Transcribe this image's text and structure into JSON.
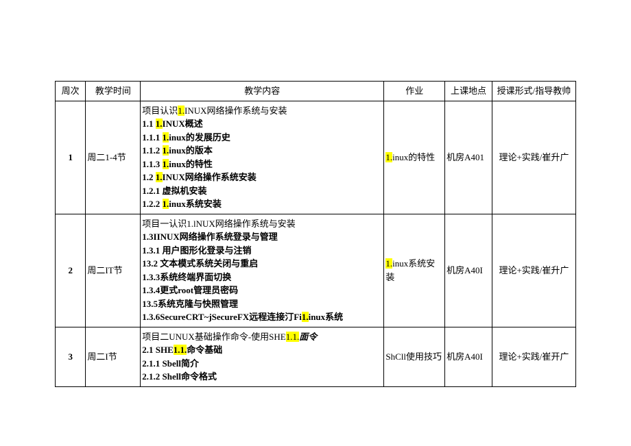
{
  "headers": {
    "week": "周次",
    "time": "教学时间",
    "content": "教学内容",
    "homework": "作业",
    "location": "上课地点",
    "mode": "授课形式/指导教帅"
  },
  "rows": [
    {
      "week": "1",
      "time": "周二1-4节",
      "content_html": "项目认识<span class='hl'>1.</span>INUX网络操作系统与安装<br><span class='bold'>1.1 <span class='hl'>1.</span>INUX概述</span><br><span class='bold'>1.1.1 <span class='hl'>1.</span>inux的发展历史</span><br><span class='bold'>1.1.2 <span class='hl'>1.</span>inux的版本</span><br><span class='bold'>1.1.3 <span class='hl'>1.</span>inux的特性</span><br><span class='bold'>1.2 <span class='hl'>1.</span>INUX网络操作系统安装</span><br><span class='bold'>1.2.1  虚拟机安装</span><br><span class='bold'>1.2.2 <span class='hl'>1.</span>inux系统安装</span>",
      "homework_html": "<span class='hl'>1.</span>inux的特性",
      "location": "机房A401",
      "mode": "理论+实践/崔升广"
    },
    {
      "week": "2",
      "time": "周二IT节",
      "content_html": "项目一认识1.lNUX网络操作系统与安装<br><span class='bold'>1.3IINUX网络操作系统登录与管理</span><br><span class='bold'>1.3.1  用户图形化登录与注销</span><br><span class='bold'>13.2 文本模式系统关闭与重启</span><br><span class='bold'>1.3.3系统终端界面切换</span><br><span class='bold'>1.3.4更式root管理员密码</span><br><span class='bold'>13.5系统克隆与快照管理</span><br><span class='bold'>1.3.6SecureCRT~jSecureFX远程连接汀Fi<span class='hl'>1.</span>inux系统</span>",
      "homework_html": "<span class='hl'>1.</span>inux系统安装",
      "location": "机房A40I",
      "mode": "理论+实践/崔升广"
    },
    {
      "week": "3",
      "time": "周二I节",
      "content_html": "项目二UNUX基础操作命令-使用SHE<span class='hl'>1.1.</span><span class='bold italic'>面令</span><br><span class='bold'>2.1 SHE<span class='hl'>1.1.</span>命令基础</span><br><span class='bold'>2.1.1 Sbell简介</span><br><span class='bold'>2.1.2 Shell命令格式</span>",
      "homework_html": "ShCll使用技巧",
      "location": "机房A40I",
      "mode": "理论+实践/崔开广"
    }
  ]
}
